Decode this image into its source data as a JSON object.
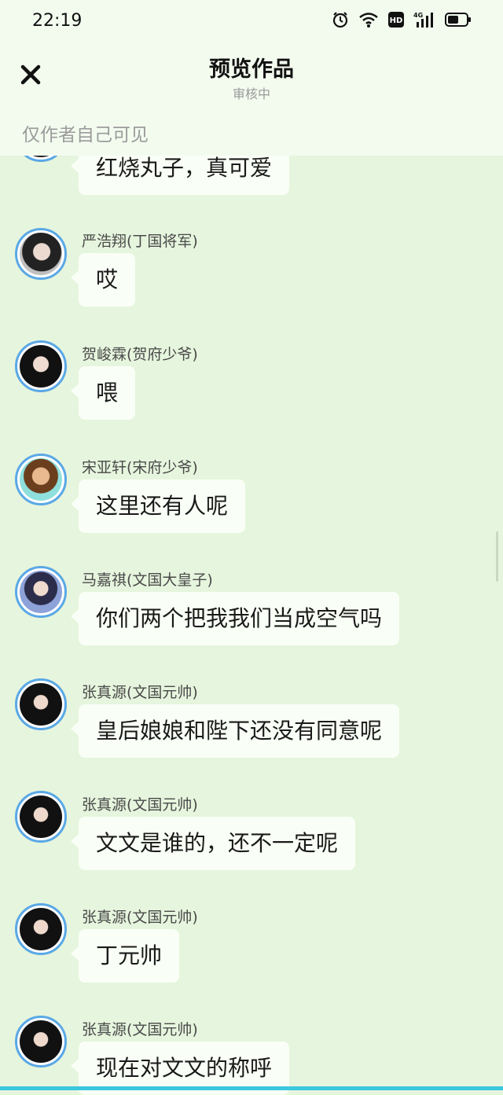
{
  "status_bar": {
    "time": "22:19",
    "icons": [
      "alarm-icon",
      "wifi-icon",
      "hd-icon",
      "signal-4g-icon",
      "battery-icon"
    ],
    "network_label": "4G",
    "hd_label": "HD"
  },
  "header": {
    "close_icon": "close-icon",
    "title": "预览作品",
    "subtitle": "审核中",
    "visibility_note": "仅作者自己可见"
  },
  "messages": [
    {
      "name": "",
      "text": "红烧丸子，真可爱"
    },
    {
      "name": "严浩翔(丁国将军)",
      "text": "哎"
    },
    {
      "name": "贺峻霖(贺府少爷)",
      "text": "喂"
    },
    {
      "name": "宋亚轩(宋府少爷)",
      "text": "这里还有人呢"
    },
    {
      "name": "马嘉祺(文国大皇子)",
      "text": "你们两个把我我们当成空气吗"
    },
    {
      "name": "张真源(文国元帅)",
      "text": "皇后娘娘和陛下还没有同意呢"
    },
    {
      "name": "张真源(文国元帅)",
      "text": "文文是谁的，还不一定呢"
    },
    {
      "name": "张真源(文国元帅)",
      "text": "丁元帅"
    },
    {
      "name": "张真源(文国元帅)",
      "text": "现在对文文的称呼"
    }
  ],
  "colors": {
    "background": "#e6f5dd",
    "header_bg": "#f3fbef",
    "bubble_bg": "#f9fff6",
    "avatar_ring": "#5aa8e6",
    "bottom_bar": "#3cc6e0"
  }
}
